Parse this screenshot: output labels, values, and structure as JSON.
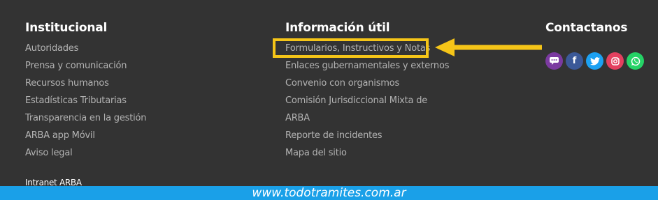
{
  "institucional": {
    "title": "Institucional",
    "links": [
      "Autoridades",
      "Prensa y comunicación",
      "Recursos humanos",
      "Estadísticas Tributarias",
      "Transparencia en la gestión",
      "ARBA app Móvil",
      "Aviso legal"
    ],
    "intranet": "Intranet ARBA"
  },
  "informacion": {
    "title": "Información útil",
    "links": [
      "Formularios, Instructivos y Notas",
      "Enlaces gubernamentales y externos",
      "Convenio con organismos",
      "Comisión Jurisdiccional Mixta de",
      "ARBA",
      "Reporte de incidentes",
      "Mapa del sitio"
    ]
  },
  "contactanos": {
    "title": "Contactanos",
    "icons": [
      {
        "name": "chat-icon",
        "color": "#7b3aa0"
      },
      {
        "name": "facebook-icon",
        "color": "#3b5998"
      },
      {
        "name": "twitter-icon",
        "color": "#1da1f2"
      },
      {
        "name": "instagram-icon",
        "color": "#e4405f"
      },
      {
        "name": "whatsapp-icon",
        "color": "#25d366"
      }
    ]
  },
  "highlight_color": "#f5c518",
  "watermark": "www.todotramites.com.ar",
  "watermark_bar_color": "#1aa0e8"
}
